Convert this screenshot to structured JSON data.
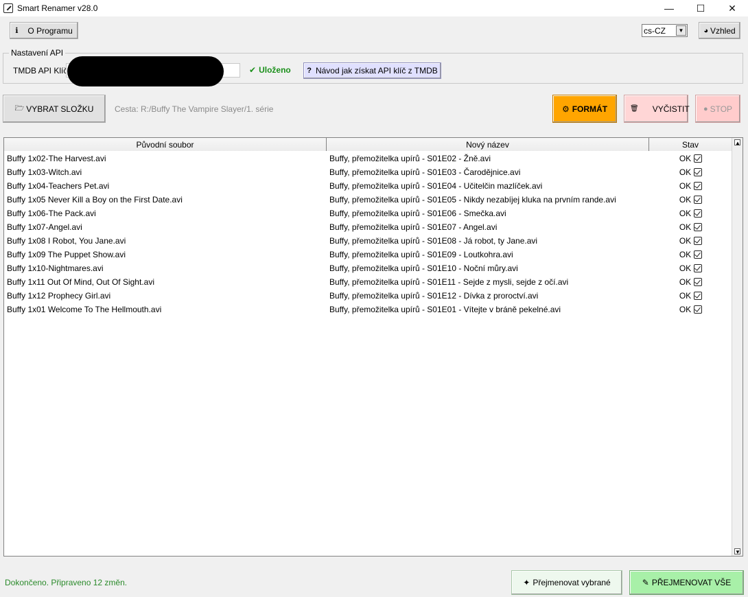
{
  "window": {
    "title": "Smart Renamer v28.0",
    "minimize": "—",
    "maximize": "☐",
    "close": "✕"
  },
  "toolbar": {
    "about_icon": "ℹ",
    "about_label": "O Programu",
    "language_value": "cs-CZ",
    "theme_icon": "◕",
    "theme_label": "Vzhled"
  },
  "api": {
    "group_label": "Nastavení API",
    "key_label": "TMDB API Klíč:",
    "saved_check": "✔",
    "saved_label": "Uloženo",
    "help_icon": "?",
    "help_label": "Návod jak získat API klíč z TMDB"
  },
  "actions": {
    "select_folder_icon": "🗁",
    "select_folder_label": "VYBRAT SLOŽKU",
    "path_text": "Cesta: R:/Buffy The Vampire Slayer/1. série",
    "format_icon": "⚙",
    "format_label": "FORMÁT",
    "clear_icon": "🗑",
    "clear_label": "VYČISTIT",
    "stop_icon": "●",
    "stop_label": "STOP"
  },
  "table": {
    "headers": [
      "Původní soubor",
      "Nový název",
      "Stav"
    ],
    "rows": [
      {
        "original": "Buffy 1x02-The Harvest.avi",
        "new": "Buffy, přemožitelka upírů  - S01E02 - Žně.avi",
        "status": "OK"
      },
      {
        "original": "Buffy 1x03-Witch.avi",
        "new": "Buffy, přemožitelka upírů  - S01E03 - Čarodějnice.avi",
        "status": "OK"
      },
      {
        "original": "Buffy 1x04-Teachers Pet.avi",
        "new": "Buffy, přemožitelka upírů  - S01E04 - Učitelčin mazlíček.avi",
        "status": "OK"
      },
      {
        "original": "Buffy 1x05 Never Kill a Boy on the First Date.avi",
        "new": "Buffy, přemožitelka upírů  - S01E05 - Nikdy nezabíjej kluka na prvním rande.avi",
        "status": "OK"
      },
      {
        "original": "Buffy 1x06-The Pack.avi",
        "new": "Buffy, přemožitelka upírů  - S01E06 - Smečka.avi",
        "status": "OK"
      },
      {
        "original": "Buffy 1x07-Angel.avi",
        "new": "Buffy, přemožitelka upírů  - S01E07 - Angel.avi",
        "status": "OK"
      },
      {
        "original": "Buffy 1x08 I Robot, You Jane.avi",
        "new": "Buffy, přemožitelka upírů  - S01E08 - Já robot, ty Jane.avi",
        "status": "OK"
      },
      {
        "original": "Buffy 1x09 The Puppet Show.avi",
        "new": "Buffy, přemožitelka upírů  - S01E09 - Loutkohra.avi",
        "status": "OK"
      },
      {
        "original": "Buffy 1x10-Nightmares.avi",
        "new": "Buffy, přemožitelka upírů  - S01E10 - Noční můry.avi",
        "status": "OK"
      },
      {
        "original": "Buffy 1x11 Out Of Mind, Out Of Sight.avi",
        "new": "Buffy, přemožitelka upírů  - S01E11 - Sejde z mysli, sejde z očí.avi",
        "status": "OK"
      },
      {
        "original": "Buffy 1x12 Prophecy Girl.avi",
        "new": "Buffy, přemožitelka upírů  - S01E12 - Dívka z proroctví.avi",
        "status": "OK"
      },
      {
        "original": "Buffy 1x01 Welcome To The Hellmouth.avi",
        "new": "Buffy, přemožitelka upírů  - S01E01 - Vítejte v bráně pekelné.avi",
        "status": "OK"
      }
    ]
  },
  "footer": {
    "status_text": "Dokončeno. Připraveno 12 změn.",
    "rename_selected_icon": "✦",
    "rename_selected_label": "Přejmenovat vybrané",
    "rename_all_icon": "✎",
    "rename_all_label": "PŘEJMENOVAT VŠE"
  },
  "colors": {
    "format_btn": "#ffa500",
    "clear_btn": "#ffd6d6",
    "stop_btn": "#ffcccc",
    "rename_selected_btn": "#eef8ee",
    "rename_all_btn": "#a8f0a8",
    "help_btn": "#e0e0ff",
    "saved_text": "#1a8f1a",
    "status_text": "#2a8a2a"
  }
}
